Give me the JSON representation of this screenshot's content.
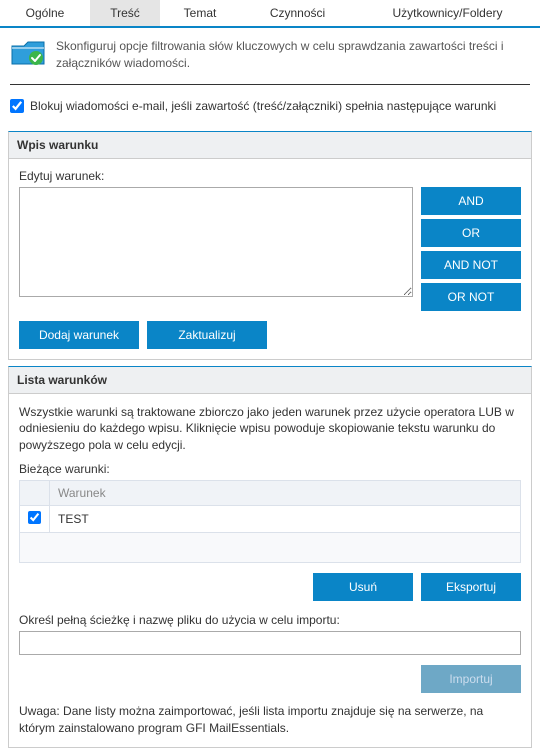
{
  "tabs": {
    "general": "Ogólne",
    "content": "Treść",
    "subject": "Temat",
    "actions": "Czynności",
    "users": "Użytkownicy/Foldery"
  },
  "intro": "Skonfiguruj opcje filtrowania słów kluczowych w celu sprawdzania zawartości treści i załączników wiadomości.",
  "block_checkbox": {
    "checked": true,
    "label": "Blokuj wiadomości e-mail, jeśli zawartość (treść/załączniki) spełnia następujące warunki"
  },
  "entry_section": {
    "title": "Wpis warunku",
    "edit_label": "Edytuj warunek:",
    "textarea_value": "",
    "ops": {
      "and": "AND",
      "or": "OR",
      "andnot": "AND NOT",
      "ornot": "OR NOT"
    },
    "add_btn": "Dodaj warunek",
    "update_btn": "Zaktualizuj"
  },
  "list_section": {
    "title": "Lista warunków",
    "desc": "Wszystkie warunki są traktowane zbiorczo jako jeden warunek przez użycie operatora LUB w odniesieniu do każdego wpisu. Kliknięcie wpisu powoduje skopiowanie tekstu warunku do powyższego pola w celu edycji.",
    "current_label": "Bieżące warunki:",
    "col_condition": "Warunek",
    "rows": [
      {
        "checked": true,
        "text": "TEST"
      }
    ],
    "delete_btn": "Usuń",
    "export_btn": "Eksportuj",
    "import_label": "Określ pełną ścieżkę i nazwę pliku do użycia w celu importu:",
    "import_value": "",
    "import_btn": "Importuj",
    "note": "Uwaga: Dane listy można zaimportować, jeśli lista importu znajduje się na serwerze, na którym zainstalowano program GFI MailEssentials."
  }
}
